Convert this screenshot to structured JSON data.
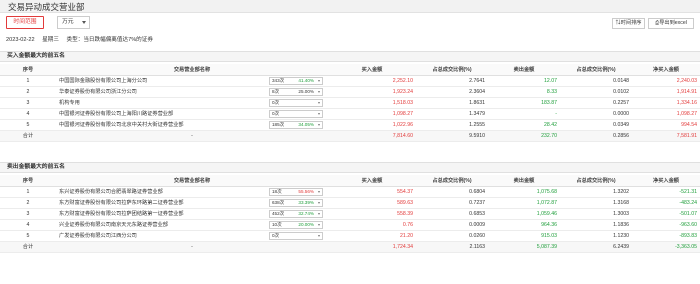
{
  "page_title": "交易异动成交营业部",
  "controls": {
    "time_range": "时间范围",
    "unit": "万元",
    "sort_time": "时间排序",
    "export": "导出到excel"
  },
  "meta": {
    "date": "2023-02-22",
    "weekday": "星期三",
    "type": "类型：当日跌幅偏离值达7%的证券"
  },
  "columns": [
    "序号",
    "交易营业部名称",
    "买入金额",
    "占总成交比例(%)",
    "卖出金额",
    "占总成交比例(%)",
    "净买入金额"
  ],
  "buy_section": {
    "title": "买入金额最大的前五名",
    "rows": [
      {
        "idx": "1",
        "name": "中国国际金融股份有限公司上海分公司",
        "count": "343次",
        "pct": "41.40%",
        "pct_color": "green",
        "buy": "2,252.10",
        "buy_ratio": "2.7641",
        "sell": "12.07",
        "sell_ratio": "0.0148",
        "net": "2,240.03",
        "net_color": "red"
      },
      {
        "idx": "2",
        "name": "华泰证券股份有限公司浙江分公司",
        "count": "8次",
        "pct": "25.00%",
        "pct_color": "",
        "buy": "1,923.24",
        "buy_ratio": "2.3604",
        "sell": "8.33",
        "sell_ratio": "0.0102",
        "net": "1,914.91",
        "net_color": "red"
      },
      {
        "idx": "3",
        "name": "机构专用",
        "count": "0次",
        "pct": "",
        "pct_color": "",
        "buy": "1,518.03",
        "buy_ratio": "1.8631",
        "sell": "183.87",
        "sell_ratio": "0.2257",
        "net": "1,334.16",
        "net_color": "red"
      },
      {
        "idx": "4",
        "name": "中国银河证券股份有限公司上海阳川路证券营业部",
        "count": "0次",
        "pct": "",
        "pct_color": "",
        "buy": "1,098.27",
        "buy_ratio": "1.3479",
        "sell": "-",
        "sell_ratio": "0.0000",
        "net": "1,098.27",
        "net_color": "red"
      },
      {
        "idx": "5",
        "name": "中国银河证券股份有限公司北京中关村大街证券营业部",
        "count": "185次",
        "pct": "34.05%",
        "pct_color": "green",
        "buy": "1,022.96",
        "buy_ratio": "1.2555",
        "sell": "28.42",
        "sell_ratio": "0.0349",
        "net": "994.54",
        "net_color": "red"
      }
    ],
    "total": {
      "idx": "合计",
      "name": "-",
      "buy": "7,814.60",
      "buy_ratio": "9.5910",
      "sell": "232.70",
      "sell_ratio": "0.2856",
      "net": "7,581.91",
      "net_color": "red"
    }
  },
  "sell_section": {
    "title": "卖出金额最大的前五名",
    "rows": [
      {
        "idx": "1",
        "name": "东兴证券股份有限公司合肥翡翠路证券营业部",
        "count": "18次",
        "pct": "55.56%",
        "pct_color": "red",
        "buy": "554.37",
        "buy_ratio": "0.6804",
        "sell": "1,075.68",
        "sell_ratio": "1.3202",
        "net": "-521.31",
        "net_color": "green"
      },
      {
        "idx": "2",
        "name": "东方财富证券股份有限公司拉萨东环路第二证券营业部",
        "count": "638次",
        "pct": "33.39%",
        "pct_color": "green",
        "buy": "589.63",
        "buy_ratio": "0.7237",
        "sell": "1,072.87",
        "sell_ratio": "1.3168",
        "net": "-483.24",
        "net_color": "green"
      },
      {
        "idx": "3",
        "name": "东方财富证券股份有限公司拉萨团结路第一证券营业部",
        "count": "452次",
        "pct": "32.74%",
        "pct_color": "green",
        "buy": "558.39",
        "buy_ratio": "0.6853",
        "sell": "1,059.46",
        "sell_ratio": "1.3003",
        "net": "-501.07",
        "net_color": "green"
      },
      {
        "idx": "4",
        "name": "兴业证券股份有限公司南京天元东路证券营业部",
        "count": "10次",
        "pct": "20.00%",
        "pct_color": "green",
        "buy": "0.76",
        "buy_ratio": "0.0009",
        "sell": "964.36",
        "sell_ratio": "1.1836",
        "net": "-963.60",
        "net_color": "green"
      },
      {
        "idx": "5",
        "name": "广发证券股份有限公司江西分公司",
        "count": "0次",
        "pct": "",
        "pct_color": "",
        "buy": "21.20",
        "buy_ratio": "0.0260",
        "sell": "915.03",
        "sell_ratio": "1.1230",
        "net": "-893.83",
        "net_color": "green"
      }
    ],
    "total": {
      "idx": "合计",
      "name": "-",
      "buy": "1,724.34",
      "buy_ratio": "2.1163",
      "sell": "5,087.39",
      "sell_ratio": "6.2439",
      "net": "-3,363.05",
      "net_color": "green"
    }
  }
}
